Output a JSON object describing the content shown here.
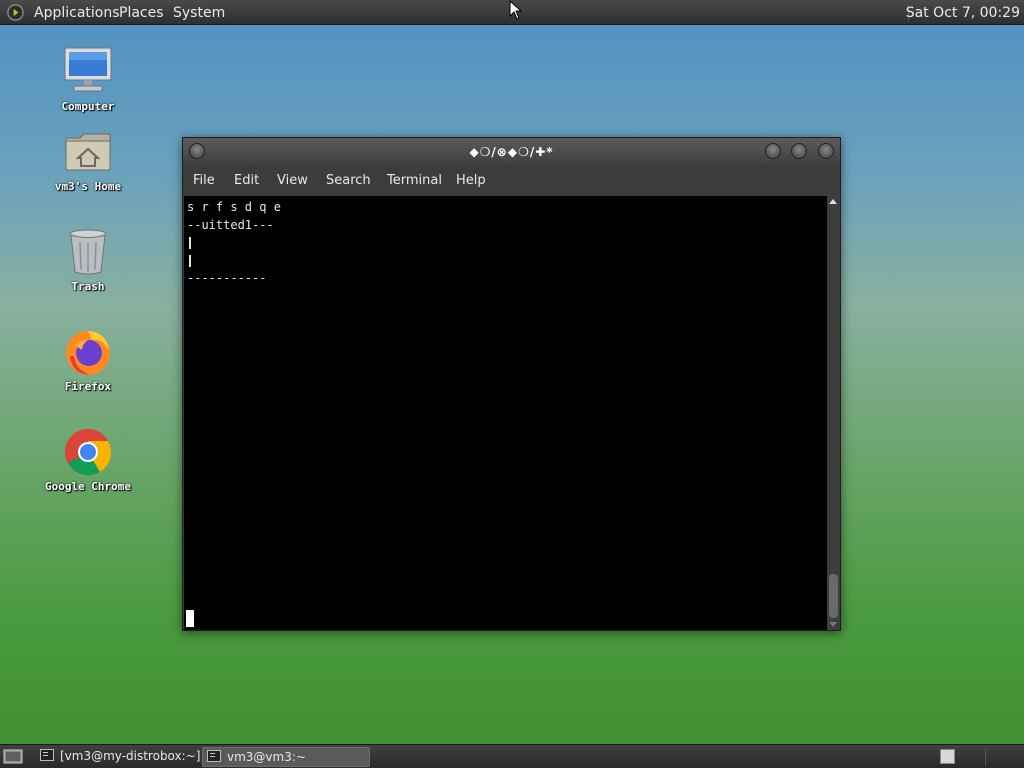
{
  "top_panel": {
    "menus": [
      "Applications",
      "Places",
      "System"
    ],
    "clock": "Sat Oct  7, 00:29",
    "logo_icon": "gnome-foot-icon"
  },
  "desktop_icons": [
    {
      "label": "Computer",
      "icon": "computer-monitor-icon"
    },
    {
      "label": "vm3's Home",
      "icon": "home-folder-icon"
    },
    {
      "label": "Trash",
      "icon": "trash-can-icon"
    },
    {
      "label": "Firefox",
      "icon": "firefox-icon"
    },
    {
      "label": "Google Chrome",
      "icon": "chrome-icon"
    }
  ],
  "terminal": {
    "title": "◆❍/⊗◆❍/✚*",
    "menus": [
      "File",
      "Edit",
      "View",
      "Search",
      "Terminal",
      "Help"
    ],
    "lines": [
      "s r f s d q e",
      "--uitted1---",
      "|",
      "|",
      "-----------"
    ],
    "colors": {
      "background": "#000000",
      "foreground": "#e8e8e8"
    }
  },
  "bottom_panel": {
    "tasks": [
      "[vm3@my-distrobox:~]",
      "vm3@vm3:~"
    ],
    "active_task_index": 1
  },
  "colors": {
    "panel": "#333333",
    "desktop_top": "#4f8fc2",
    "desktop_bottom": "#3f8f30"
  }
}
